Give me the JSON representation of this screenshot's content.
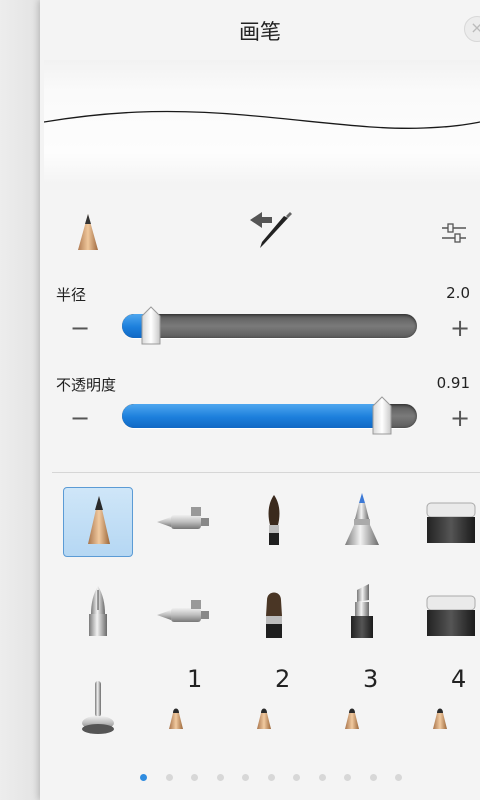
{
  "header": {
    "title": "画笔",
    "close_icon": "close-icon"
  },
  "toolbar": {
    "current_brush_icon": "pencil-tip-icon",
    "swap_icon": "brush-swap-icon",
    "settings_icon": "sliders-icon"
  },
  "radius": {
    "label": "半径",
    "value": "2.0",
    "fraction": 0.07,
    "minus": "−",
    "plus": "+"
  },
  "opacity": {
    "label": "不透明度",
    "value": "0.91",
    "fraction": 0.91,
    "minus": "−",
    "plus": "+"
  },
  "brushes": [
    {
      "icon": "pencil-icon",
      "selected": true
    },
    {
      "icon": "airbrush-icon",
      "selected": false
    },
    {
      "icon": "paintbrush-icon",
      "selected": false
    },
    {
      "icon": "marker-icon",
      "selected": false
    },
    {
      "icon": "eraser-icon",
      "selected": false
    },
    {
      "icon": "ink-pen-icon",
      "selected": false
    },
    {
      "icon": "airbrush-2-icon",
      "selected": false
    },
    {
      "icon": "flat-brush-icon",
      "selected": false
    },
    {
      "icon": "chisel-marker-icon",
      "selected": false
    },
    {
      "icon": "eraser-2-icon",
      "selected": false
    },
    {
      "icon": "stamp-tool-icon",
      "selected": false
    },
    {
      "icon": "custom-brush-icon",
      "label": "1",
      "selected": false
    },
    {
      "icon": "custom-brush-icon",
      "label": "2",
      "selected": false
    },
    {
      "icon": "custom-brush-icon",
      "label": "3",
      "selected": false
    },
    {
      "icon": "custom-brush-icon",
      "label": "4",
      "selected": false
    }
  ],
  "pager": {
    "pages": 11,
    "current": 0
  },
  "colors": {
    "accent": "#1c7fdc",
    "track": "#666666"
  }
}
